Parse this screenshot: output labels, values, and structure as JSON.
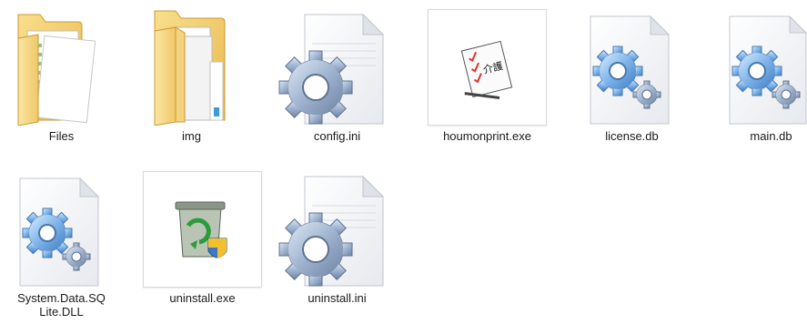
{
  "files": [
    {
      "name": "Files",
      "type": "folder"
    },
    {
      "name": "img",
      "type": "folder"
    },
    {
      "name": "config.ini",
      "type": "ini-file",
      "icon": "gear-document-icon"
    },
    {
      "name": "houmonprint.exe",
      "type": "exe-file",
      "icon": "houmonprint-app-icon",
      "badge_text": "介護"
    },
    {
      "name": "license.db",
      "type": "db-file",
      "icon": "gear-document-icon"
    },
    {
      "name": "main.db",
      "type": "db-file",
      "icon": "gear-document-icon"
    },
    {
      "name": "System.Data.SQLite.DLL",
      "type": "dll-file",
      "icon": "gear-document-icon"
    },
    {
      "name": "uninstall.exe",
      "type": "exe-file",
      "icon": "recycle-bin-shield-icon"
    },
    {
      "name": "uninstall.ini",
      "type": "ini-file",
      "icon": "gear-document-icon"
    }
  ]
}
